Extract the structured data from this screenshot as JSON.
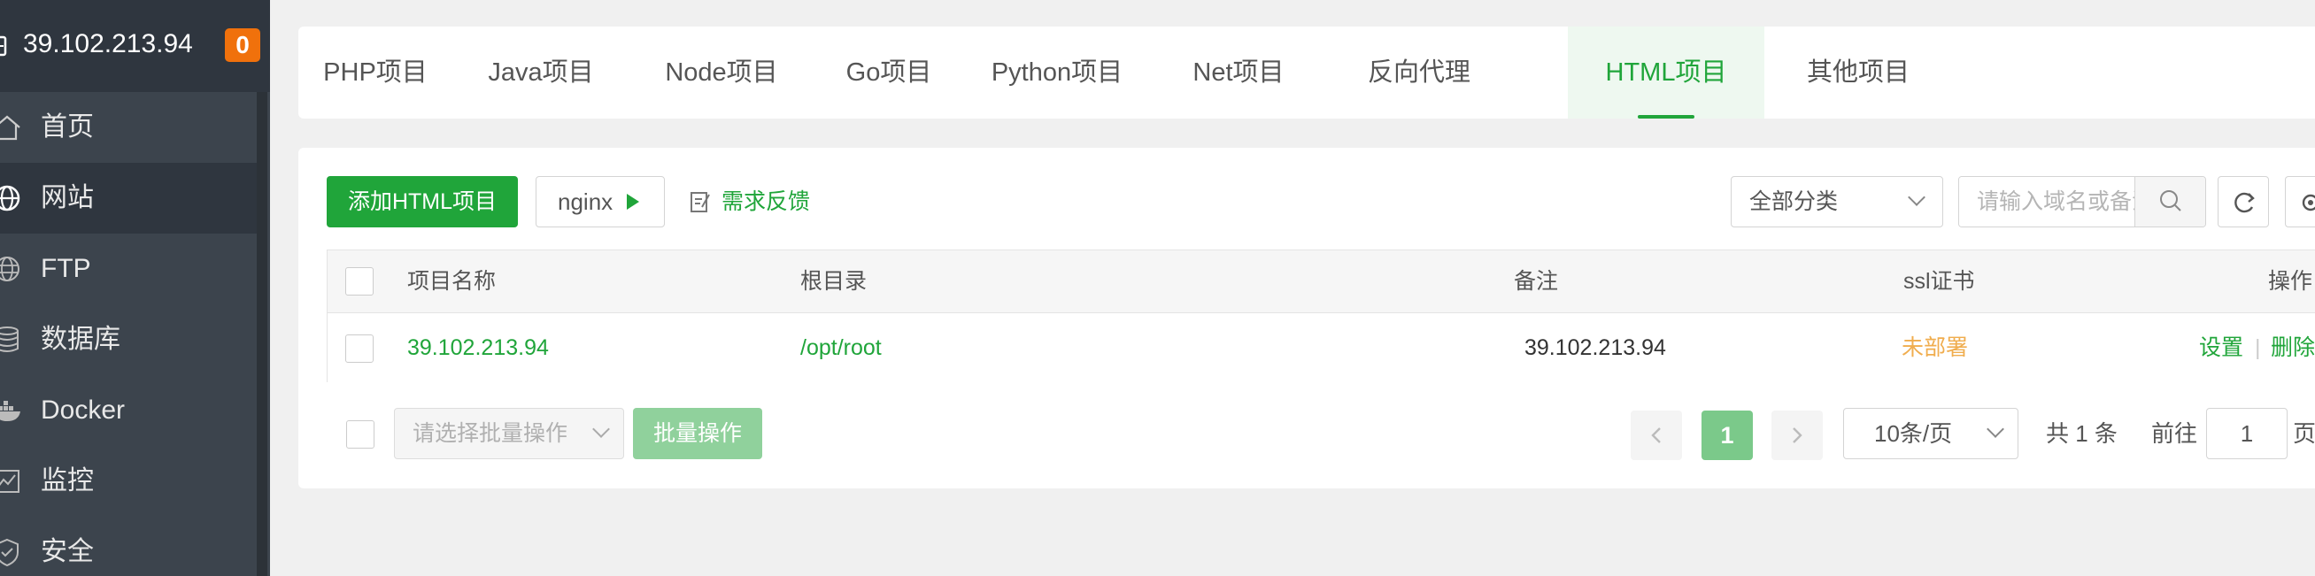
{
  "sidebar": {
    "host": "39.102.213.94",
    "badge": "0",
    "items": [
      {
        "label": "首页",
        "icon": "home-icon"
      },
      {
        "label": "网站",
        "icon": "globe-icon",
        "active": true
      },
      {
        "label": "FTP",
        "icon": "ftp-globe-icon"
      },
      {
        "label": "数据库",
        "icon": "database-icon"
      },
      {
        "label": "Docker",
        "icon": "docker-icon"
      },
      {
        "label": "监控",
        "icon": "monitor-icon"
      },
      {
        "label": "安全",
        "icon": "shield-icon"
      }
    ]
  },
  "tabs": [
    {
      "label": "PHP项目"
    },
    {
      "label": "Java项目"
    },
    {
      "label": "Node项目"
    },
    {
      "label": "Go项目"
    },
    {
      "label": "Python项目"
    },
    {
      "label": "Net项目"
    },
    {
      "label": "反向代理"
    },
    {
      "label": "HTML项目",
      "active": true
    },
    {
      "label": "其他项目"
    }
  ],
  "toolbar": {
    "add_label": "添加HTML项目",
    "nginx_label": "nginx",
    "feedback_label": "需求反馈",
    "category_value": "全部分类",
    "search_placeholder": "请输入域名或备注"
  },
  "table": {
    "columns": [
      "项目名称",
      "根目录",
      "备注",
      "ssl证书",
      "操作"
    ],
    "rows": [
      {
        "name": "39.102.213.94",
        "root": "/opt/root",
        "note": "39.102.213.94",
        "ssl": "未部署",
        "actions": [
          "设置",
          "删除"
        ],
        "separator": "|"
      }
    ]
  },
  "footer": {
    "batch_placeholder": "请选择批量操作",
    "batch_button": "批量操作",
    "current_page": "1",
    "page_size": "10条/页",
    "total": "共 1 条",
    "goto_label": "前往",
    "goto_value": "1",
    "goto_unit": "页"
  },
  "colors": {
    "accent": "#20a53a",
    "sidebar_bg": "#3c444d",
    "sidebar_header_bg": "#2f363f",
    "badge": "#f0710c",
    "warning": "#f0ad4e"
  }
}
